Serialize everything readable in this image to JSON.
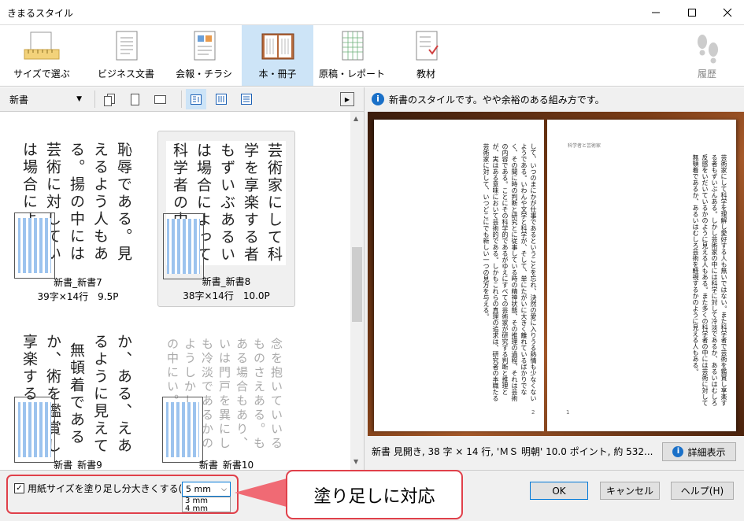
{
  "window": {
    "title": "きまるスタイル"
  },
  "toolbar": {
    "items": [
      {
        "label": "サイズで選ぶ",
        "icon": "ruler-icon"
      },
      {
        "label": "ビジネス文書",
        "icon": "document-icon"
      },
      {
        "label": "会報・チラシ",
        "icon": "flyer-icon"
      },
      {
        "label": "本・冊子",
        "icon": "book-icon",
        "active": true
      },
      {
        "label": "原稿・レポート",
        "icon": "manuscript-icon"
      },
      {
        "label": "教材",
        "icon": "worksheet-icon"
      }
    ],
    "history": "履歴"
  },
  "left": {
    "category": "新書",
    "thumbs": [
      {
        "name": "新書_新書7",
        "info": "39字×14行　9.5P",
        "text": "恥辱である。見えるよう人もある。揚の中には芸術に対していは場合によっては楽する者もずいぶんあ芸術家にして科学を"
      },
      {
        "name": "新書_新書8",
        "info": "38字×14行　10.0P",
        "text": "芸術家にして科学を享楽する者もずいぶあるいは場合によって科学者の中には芸術かのように見えるあり、また"
      },
      {
        "name": "新書_新書9",
        "info": "",
        "text": "か、ある、えあるように見えて無頓着であるか、術を鑑賞し享楽する芸術家にして科学"
      },
      {
        "name": "新書_新書10",
        "info": "",
        "text": "念を抱いていいるものさえある。もある場合もあり、いは門戸を異にしも冷淡であるかのようしかし芸術家の中にい。また科学者で芸術を芸術家にして科学を理解"
      }
    ]
  },
  "right": {
    "info": "新書のスタイルです。やや余裕のある組み方です。",
    "page_left_text": "して、いつのまにかが仕事であるということを忘れ、決然の愛に入りうる熱情も少なくないようである。いわんや文学と科学が、そして、単にたがいに大きく離れているばかりでなく、その間に時の判断と研究とに従事している時の精神状態、その推理の過程、それは芸術の内容である。ことにその科学的であるがゆえにすべての芸術家が研究する判断と推理とが、実はある意味において芸術的である。しかもこれらの真理の追求は、研究者の本職たる芸術家に対して、いつどこにでも新しい一つの見方を与える。",
    "page_right_text": "芸術家にして科学を理解し愛好する人も無いではない。また科学者で芸術を鑑賞し享楽する者もずいぶんある。しかし芸術家の中には科学に対して冷淡であるか、あるいはむしろ反感をいだいているかのように見える人もある。また多くの科学者の中には芸術に対して無頓着であるか、あるいはむしろ芸術を軽視するかのように見える人もある。",
    "header_text": "科学者と芸術家",
    "page_num_left": "2",
    "page_num_right": "1",
    "status": "新書 見開き, 38 字 × 14 行, 'ＭＳ 明朝' 10.0 ポイント, 約 532...",
    "details_button": "詳細表示"
  },
  "bottom": {
    "checkbox_label": "用紙サイズを塗り足し分大きくする(S)",
    "checked": true,
    "bleed_value": "5 mm",
    "bleed_options": [
      "3 mm",
      "4 mm"
    ],
    "callout": "塗り足しに対応",
    "ok": "OK",
    "cancel": "キャンセル",
    "help": "ヘルプ(H)"
  },
  "colors": {
    "accent": "#cde4f7",
    "callout_border": "#e0404a",
    "callout_pointer": "#f06a74"
  }
}
